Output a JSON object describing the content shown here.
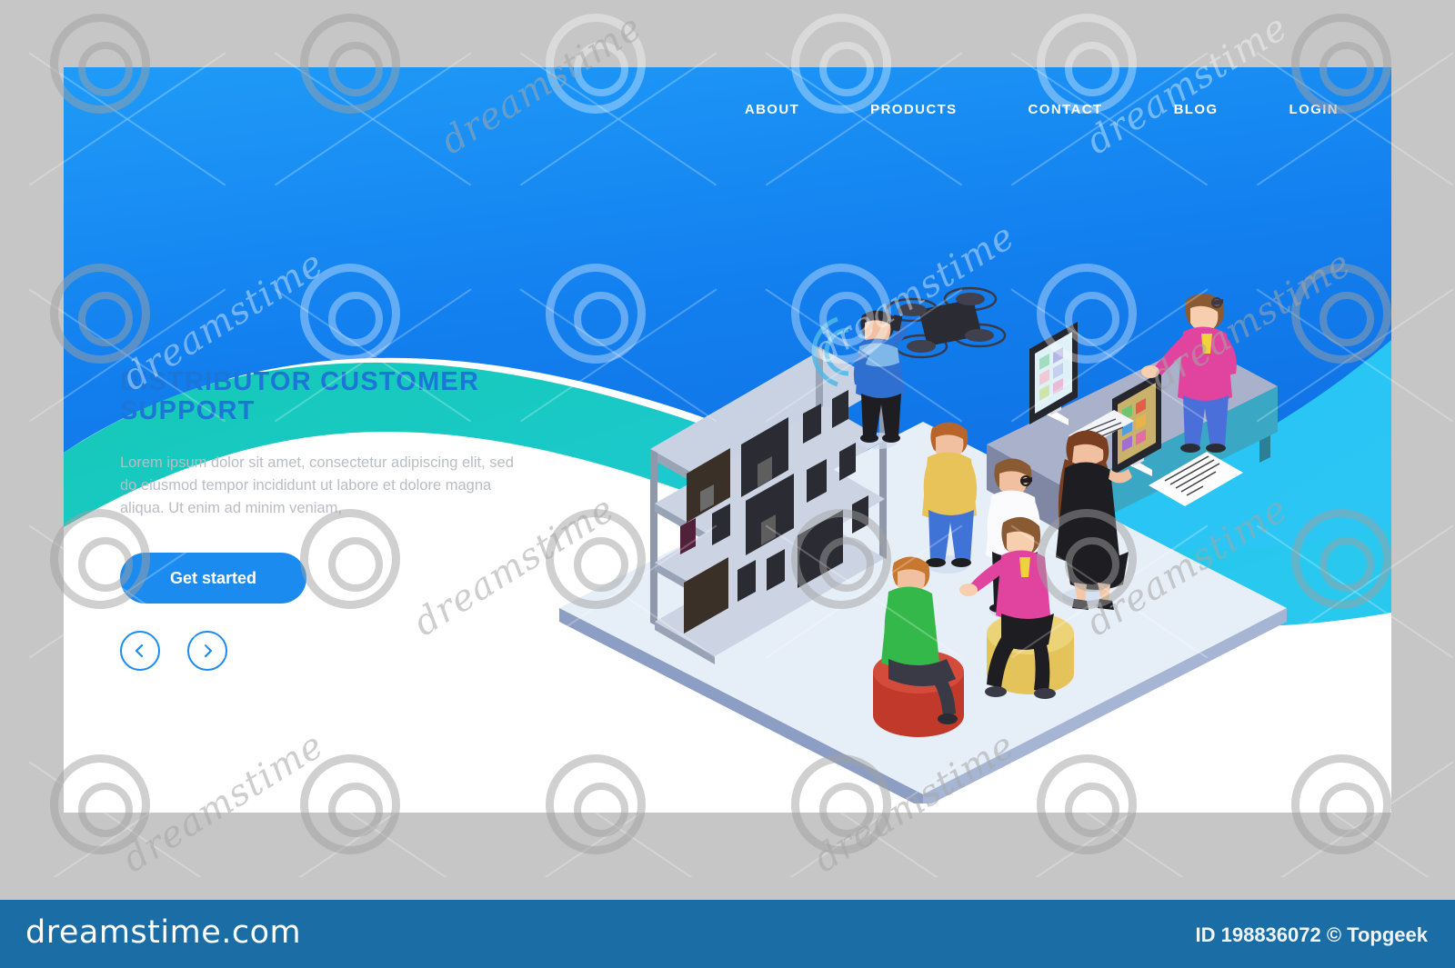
{
  "stock": {
    "background_color": "#c6c6c6",
    "watermark_word": "dreamstime",
    "footer": {
      "logo_text": "dreamstime.com",
      "credit_text": "ID 198836072 © Topgeek",
      "bar_color": "#1a6ea5"
    }
  },
  "page": {
    "card_background": "#ffffff",
    "accent_blue": "#1b8bf0",
    "title_blue": "#1b76d8",
    "wave_blue_top": "#1a8cf5",
    "wave_blue_deep": "#1176e8",
    "wave_teal": "#19c6c0",
    "wave_cyan": "#25c6f0"
  },
  "nav": {
    "items": [
      {
        "label": "ABOUT"
      },
      {
        "label": "PRODUCTS"
      },
      {
        "label": "CONTACT"
      },
      {
        "label": "BLOG"
      },
      {
        "label": "LOGIN"
      }
    ]
  },
  "hero": {
    "title": "DISTRIBUTOR CUSTOMER SUPPORT",
    "description": "Lorem ipsum dolor sit amet, consectetur adipiscing elit, sed do eiusmod tempor incididunt ut labore et dolore magna aliqua. Ut enim ad minim veniam,",
    "cta_label": "Get started"
  },
  "carousel": {
    "prev_label": "Previous slide",
    "next_label": "Next slide"
  },
  "illustration": {
    "scene_name": "isometric electronics store customer support",
    "elements": [
      "display-shelf-unit",
      "service-counter-desk",
      "desktop-monitor-left",
      "desktop-monitor-right",
      "paper-document",
      "quadcopter-drone",
      "man-on-phone",
      "customer-yellow-shirt",
      "customer-white-shirt",
      "staff-black-dress",
      "staff-pink-shirt",
      "seated-customer-green-shirt",
      "seated-staff-pink-shirt",
      "red-ottoman",
      "yellow-ottoman"
    ],
    "colors": {
      "floor": "#e3ecf5",
      "floor_side": "#8b9ec4",
      "shelf_frame": "#9aa4b5",
      "shelf_panel": "#ccd4e4",
      "desk_top": "#a9b0c8",
      "desk_front": "#3aa8c4",
      "device_dark": "#2b2b33",
      "ottoman_red": "#c0392b",
      "ottoman_yellow": "#e3c35a",
      "shirt_pink": "#e0449e",
      "shirt_green": "#35b84a",
      "shirt_yellow": "#e8c35a",
      "shirt_blue": "#2f6fd0",
      "dress_black": "#1d1d22",
      "jeans_blue": "#3f74d6"
    }
  }
}
